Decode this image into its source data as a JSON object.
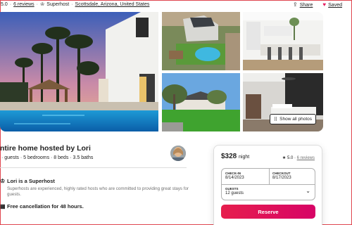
{
  "meta": {
    "rating": "5.0",
    "reviews_link": "6 reviews",
    "superhost": "Superhost",
    "location": "Scottsdale, Arizona, United States",
    "share": "Share",
    "saved": "Saved"
  },
  "gallery": {
    "show_all_label": "Show all photos"
  },
  "listing": {
    "title": "ntire home hosted by Lori",
    "subtitle": "· guests · 5 bedrooms · 8 beds · 3.5 baths"
  },
  "features": [
    {
      "title": "Lori is a Superhost",
      "desc": "Superhosts are experienced, highly rated hosts who are committed to providing great stays for guests.",
      "icon": "medal-icon"
    },
    {
      "title": "Free cancellation for 48 hours.",
      "icon": "calendar-icon"
    }
  ],
  "booking": {
    "price": "$328",
    "per": "night",
    "rating": "5.0 ·",
    "reviews": "6 reviews",
    "checkin_label": "CHECK-IN",
    "checkin_value": "8/14/2023",
    "checkout_label": "CHECKOUT",
    "checkout_value": "8/17/2023",
    "guests_label": "GUESTS",
    "guests_value": "12 guests",
    "reserve_label": "Reserve"
  },
  "colors": {
    "brand": "#e31c5f",
    "reserve_start": "#e61e4d",
    "reserve_end": "#d70466"
  }
}
